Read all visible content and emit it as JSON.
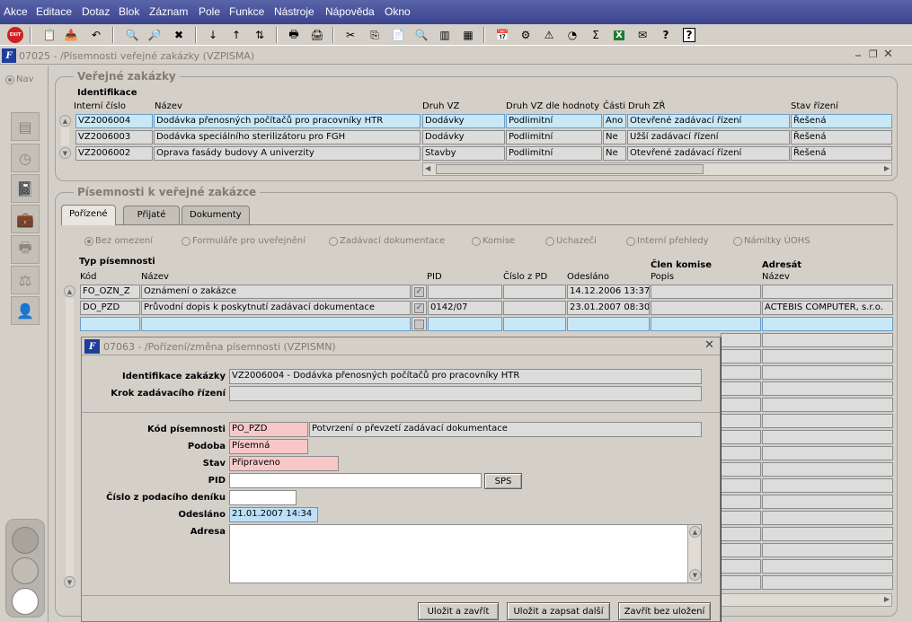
{
  "menu": [
    "Akce",
    "Editace",
    "Dotaz",
    "Blok",
    "Záznam",
    "Pole",
    "Funkce",
    "Nástroje",
    "Nápověda",
    "Okno"
  ],
  "main_window": {
    "title": "07025 - /Písemnosti veřejné zakázky (VZPISMA)",
    "nav_label": "Nav"
  },
  "verejne_zakazky": {
    "group_title": "Veřejné zakázky",
    "section_label": "Identifikace",
    "headers": [
      "Interní číslo",
      "Název",
      "Druh VZ",
      "Druh VZ dle hodnoty",
      "Části",
      "Druh ZŘ",
      "Stav řízení"
    ],
    "rows": [
      [
        "VZ2006004",
        "Dodávka přenosných počítačů pro pracovníky HTR",
        "Dodávky",
        "Podlimitní",
        "Ano",
        "Otevřené zadávací řízení",
        "Řešená"
      ],
      [
        "VZ2006003",
        "Dodávka speciálního sterilizátoru pro FGH",
        "Dodávky",
        "Podlimitní",
        "Ne",
        "Užší zadávací řízení",
        "Řešená"
      ],
      [
        "VZ2006002",
        "Oprava fasády budovy A univerzity",
        "Stavby",
        "Podlimitní",
        "Ne",
        "Otevřené zadávací řízení",
        "Řešená"
      ]
    ]
  },
  "pisemnosti": {
    "group_title": "Písemnosti k veřejné zakázce",
    "tabs": [
      "Pořízené",
      "Přijaté",
      "Dokumenty"
    ],
    "filters": [
      "Bez omezení",
      "Formuláře pro uveřejnění",
      "Zadávací dokumentace",
      "Komise",
      "Uchazeči",
      "Interní přehledy",
      "Námitky ÚOHS"
    ],
    "typ_label": "Typ písemnosti",
    "clen_label": "Člen komise",
    "adresat_label": "Adresát",
    "headers": [
      "Kód",
      "Název",
      "PID",
      "Číslo z PD",
      "Odesláno",
      "Popis",
      "Název"
    ],
    "rows": [
      [
        "FO_OZN_Z",
        "Oznámení o zakázce",
        "",
        "",
        "14.12.2006 13:37",
        "",
        ""
      ],
      [
        "DO_PZD",
        "Průvodní dopis k poskytnutí zadávací dokumentace",
        "0142/07",
        "",
        "23.01.2007 08:30",
        "",
        "ACTEBIS COMPUTER, s.r.o."
      ]
    ]
  },
  "dialog": {
    "title": "07063 - /Pořízení/změna písemnosti (VZPISMN)",
    "labels": {
      "identifikace": "Identifikace zakázky",
      "krok": "Krok zadávacího řízení",
      "kod": "Kód písemnosti",
      "podoba": "Podoba",
      "stav": "Stav",
      "pid": "PID",
      "cislo": "Číslo z podacího deníku",
      "odeslano": "Odesláno",
      "adresa": "Adresa"
    },
    "values": {
      "identifikace": "VZ2006004 - Dodávka přenosných počítačů pro pracovníky HTR",
      "krok": "",
      "kod": "PO_PZD",
      "kod_nazev": "Potvrzení o převzetí zadávací dokumentace",
      "podoba": "Písemná",
      "stav": "Připraveno",
      "pid": "",
      "cislo": "",
      "odeslano": "21.01.2007 14:34",
      "adresa": ""
    },
    "sps_button": "SPS",
    "buttons": [
      "Uložit a zavřít",
      "Uložit a zapsat další",
      "Zavřít bez uložení"
    ]
  }
}
